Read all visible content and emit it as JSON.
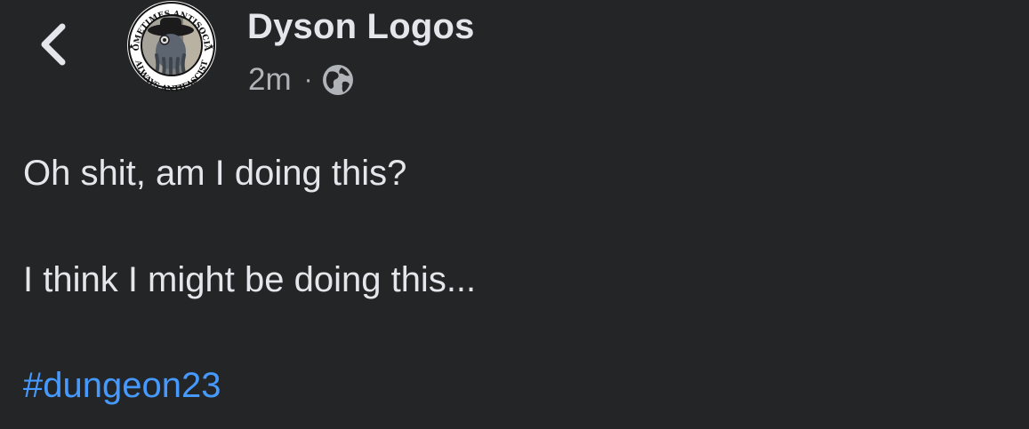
{
  "header": {
    "back_icon": "chevron-left-icon",
    "author_name": "Dyson Logos",
    "avatar": {
      "icon": "avatar-badge",
      "ring_text_top": "SOMETIMES ANTISOCIAL",
      "ring_text_bottom": "ALWAYS ANTIFASCIST"
    },
    "timestamp": "2m",
    "separator": "·",
    "privacy_icon": "globe-icon"
  },
  "post": {
    "line_1": "Oh shit, am I doing this?",
    "line_2": "I think I might be doing this...",
    "hashtag": "#dungeon23"
  },
  "colors": {
    "background": "#242526",
    "primary_text": "#e4e6eb",
    "secondary_text": "#b0b3b8",
    "link": "#4599ff"
  }
}
